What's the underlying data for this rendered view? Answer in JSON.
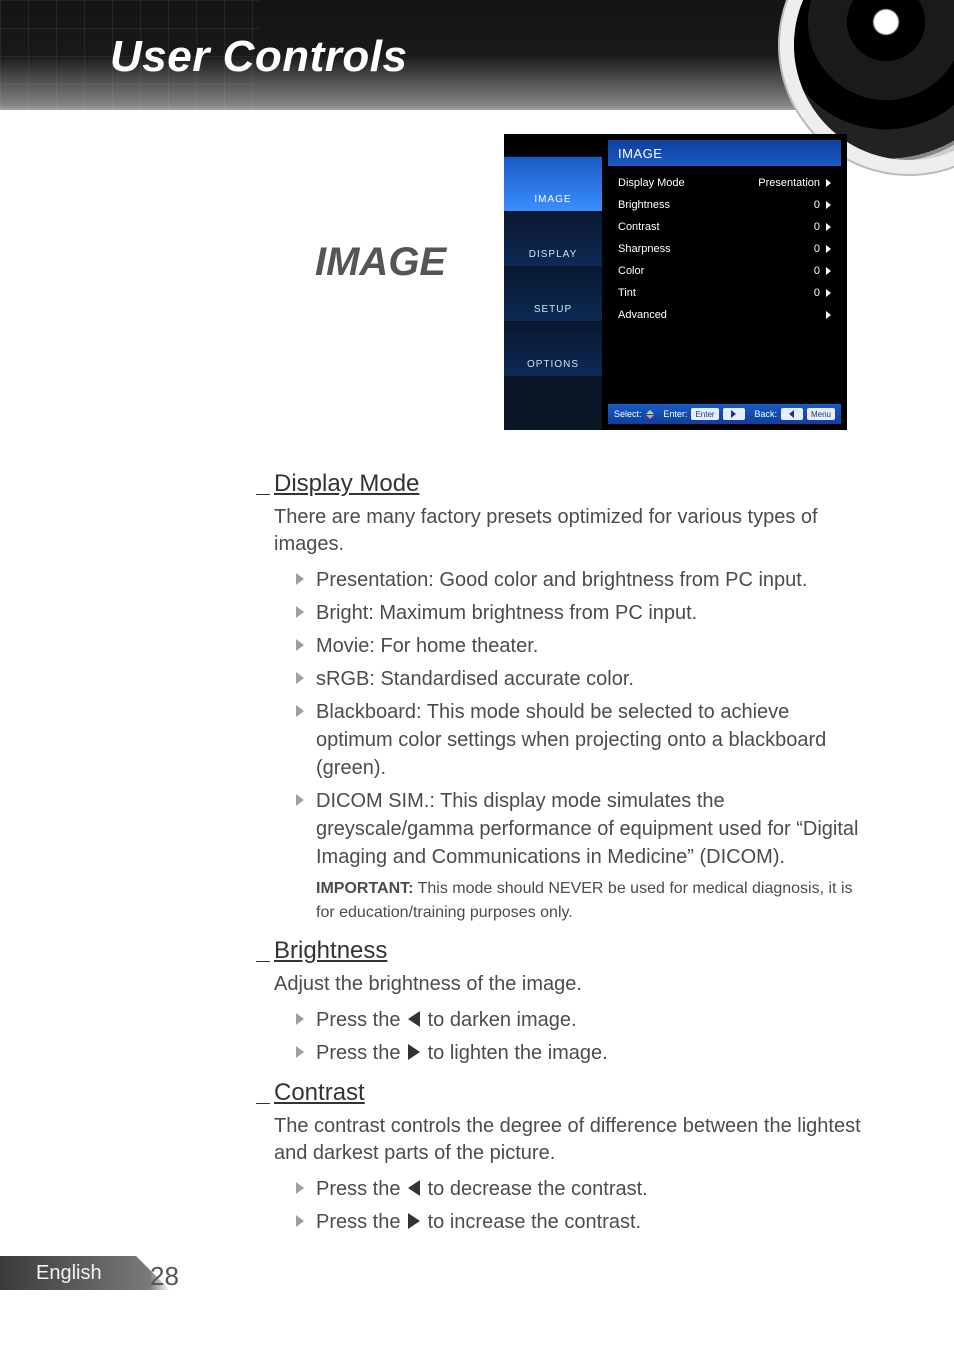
{
  "chapter_title": "User Controls",
  "section_label": "IMAGE",
  "osd": {
    "tabs": [
      "IMAGE",
      "DISPLAY",
      "SETUP",
      "OPTIONS"
    ],
    "header": "IMAGE",
    "rows": [
      {
        "label": "Display Mode",
        "value": "Presentation"
      },
      {
        "label": "Brightness",
        "value": "0"
      },
      {
        "label": "Contrast",
        "value": "0"
      },
      {
        "label": "Sharpness",
        "value": "0"
      },
      {
        "label": "Color",
        "value": "0"
      },
      {
        "label": "Tint",
        "value": "0"
      },
      {
        "label": "Advanced",
        "value": ""
      }
    ],
    "footer": {
      "select_label": "Select:",
      "enter_label": "Enter:",
      "enter_key": "Enter",
      "back_label": "Back:",
      "back_key": "Menu"
    }
  },
  "body": {
    "display_mode": {
      "heading": "Display Mode",
      "intro": "There are many factory presets optimized for various types of images.",
      "items": [
        "Presentation: Good color and brightness from PC input.",
        "Bright: Maximum brightness from PC input.",
        "Movie: For home theater.",
        "sRGB: Standardised accurate color.",
        "Blackboard: This mode should be selected to achieve optimum color settings when projecting onto a blackboard (green).",
        "DICOM SIM.: This display mode simulates the greyscale/gamma performance of equipment used for “Digital Imaging and Communications in Medicine” (DICOM)."
      ],
      "important_label": "IMPORTANT:",
      "important_text": " This mode should NEVER be used for medical diagnosis, it is for education/training purposes only."
    },
    "brightness": {
      "heading": "Brightness",
      "intro": "Adjust the brightness of the image.",
      "press_prefix": "Press the ",
      "item1_suffix": " to darken image.",
      "item2_suffix": " to lighten the image."
    },
    "contrast": {
      "heading": "Contrast",
      "intro": "The contrast controls the degree of difference between the lightest and darkest parts of the picture.",
      "press_prefix": "Press the ",
      "item1_suffix": " to decrease the contrast.",
      "item2_suffix": " to increase the contrast."
    }
  },
  "footer": {
    "language": "English",
    "page": "28"
  }
}
